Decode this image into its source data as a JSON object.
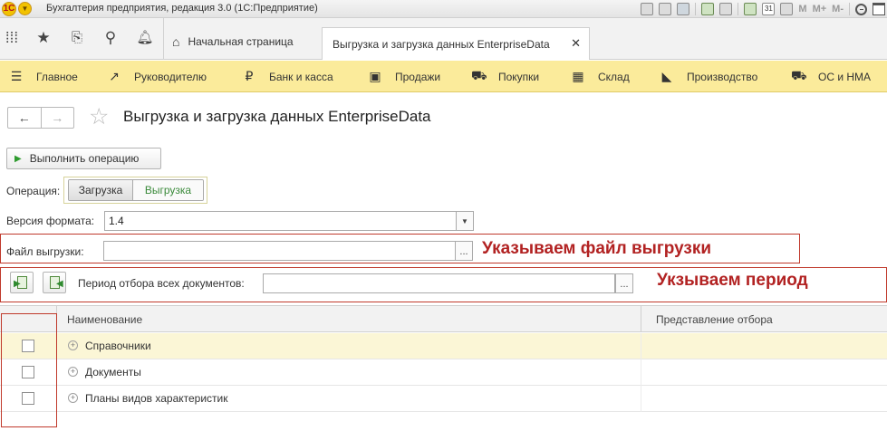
{
  "window": {
    "title": "Бухгалтерия предприятия, редакция 3.0  (1С:Предприятие)",
    "logo_text": "1С",
    "memory_buttons": [
      "M",
      "M+",
      "M-"
    ],
    "calendar_text": "31"
  },
  "tabs": {
    "home_label": "Начальная страница",
    "active_label": "Выгрузка и загрузка данных EnterpriseData",
    "close_glyph": "✕"
  },
  "sections": [
    {
      "label": "Главное",
      "icon": "menu-icon"
    },
    {
      "label": "Руководителю",
      "icon": "trend-icon"
    },
    {
      "label": "Банк и касса",
      "icon": "ruble-icon"
    },
    {
      "label": "Продажи",
      "icon": "bag-icon"
    },
    {
      "label": "Покупки",
      "icon": "cart-icon"
    },
    {
      "label": "Склад",
      "icon": "warehouse-icon"
    },
    {
      "label": "Производство",
      "icon": "factory-icon"
    },
    {
      "label": "ОС и НМА",
      "icon": "truck-icon"
    }
  ],
  "page": {
    "title": "Выгрузка и загрузка данных EnterpriseData"
  },
  "actions": {
    "run_label": "Выполнить операцию"
  },
  "operation": {
    "label": "Операция:",
    "options": [
      "Загрузка",
      "Выгрузка"
    ],
    "selected": "Выгрузка"
  },
  "format": {
    "label": "Версия формата:",
    "value": "1.4"
  },
  "export_file": {
    "label": "Файл выгрузки:",
    "value": "",
    "button": "..."
  },
  "period": {
    "label": "Период отбора всех документов:",
    "value": "",
    "button": "..."
  },
  "annotations": {
    "file": "Указываем  файл выгрузки",
    "period": "Укзываем период"
  },
  "colors": {
    "section_bar": "#fbeb9b",
    "annotation": "#b22222",
    "selected_row": "#fbf6d6",
    "active_option": "#3a8a3a"
  },
  "table": {
    "columns": [
      "",
      "Наименование",
      "Представление отбора"
    ],
    "rows": [
      {
        "name": "Справочники",
        "checked": false,
        "filter": ""
      },
      {
        "name": "Документы",
        "checked": false,
        "filter": ""
      },
      {
        "name": "Планы видов характеристик",
        "checked": false,
        "filter": ""
      }
    ]
  }
}
